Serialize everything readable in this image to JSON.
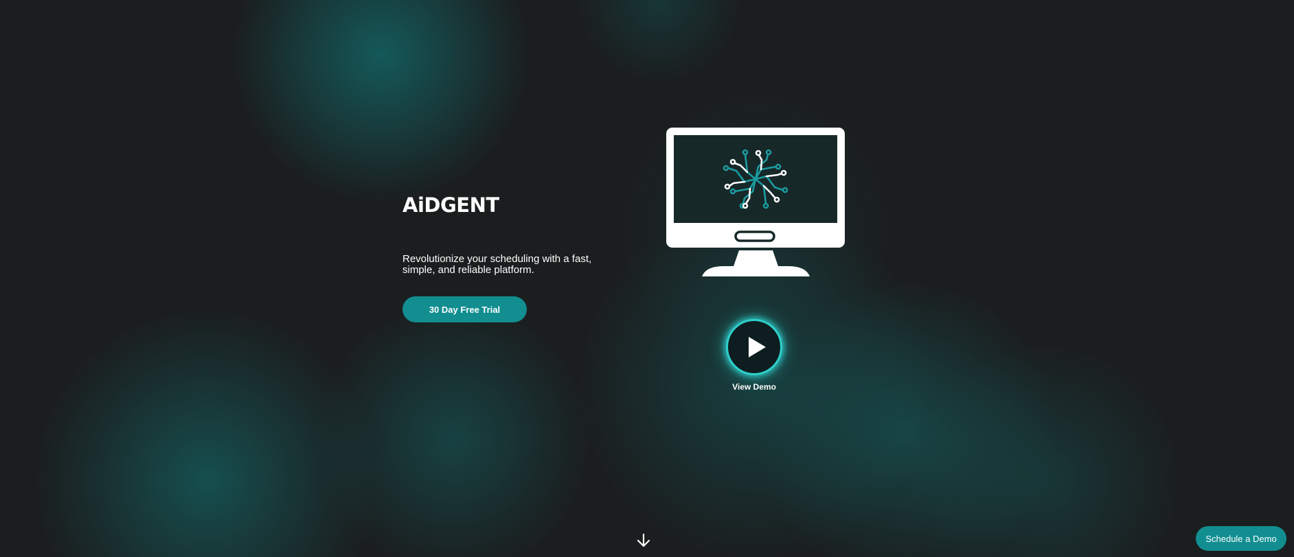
{
  "hero": {
    "brand": "AiDGENT",
    "tagline": "Revolutionize your scheduling with a fast, simple, and reliable platform.",
    "trial_button_label": "30 Day Free Trial"
  },
  "demo": {
    "label": "View Demo",
    "play_icon": "play-icon"
  },
  "illustration": {
    "icon": "monitor-circuit-icon"
  },
  "scroll_indicator": {
    "icon": "arrow-down-icon"
  },
  "floating_cta": {
    "label": "Schedule a Demo"
  },
  "colors": {
    "background": "#1b1e1f",
    "accent": "#128e91",
    "glow": "#2fd0cc",
    "text": "#ffffff"
  }
}
